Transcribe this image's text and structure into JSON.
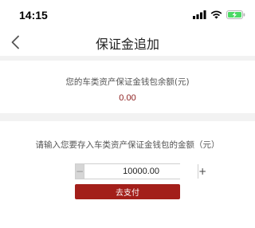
{
  "status_bar": {
    "time": "14:15",
    "icons": [
      "signal-icon",
      "wifi-icon",
      "battery-charging-icon"
    ],
    "battery_color": "#4cd964"
  },
  "nav": {
    "back_icon": "chevron-left-icon",
    "title": "保证金追加"
  },
  "balance": {
    "label": "您的车类资产保证金钱包余额(元)",
    "value": "0.00",
    "value_color": "#8b1c1c"
  },
  "deposit": {
    "label": "请输入您要存入车类资产保证金钱包的金额（元）",
    "amount": "10000.00",
    "minus_label": "−",
    "plus_label": "+",
    "pay_button_label": "去支付",
    "accent_color": "#a31f1a"
  }
}
